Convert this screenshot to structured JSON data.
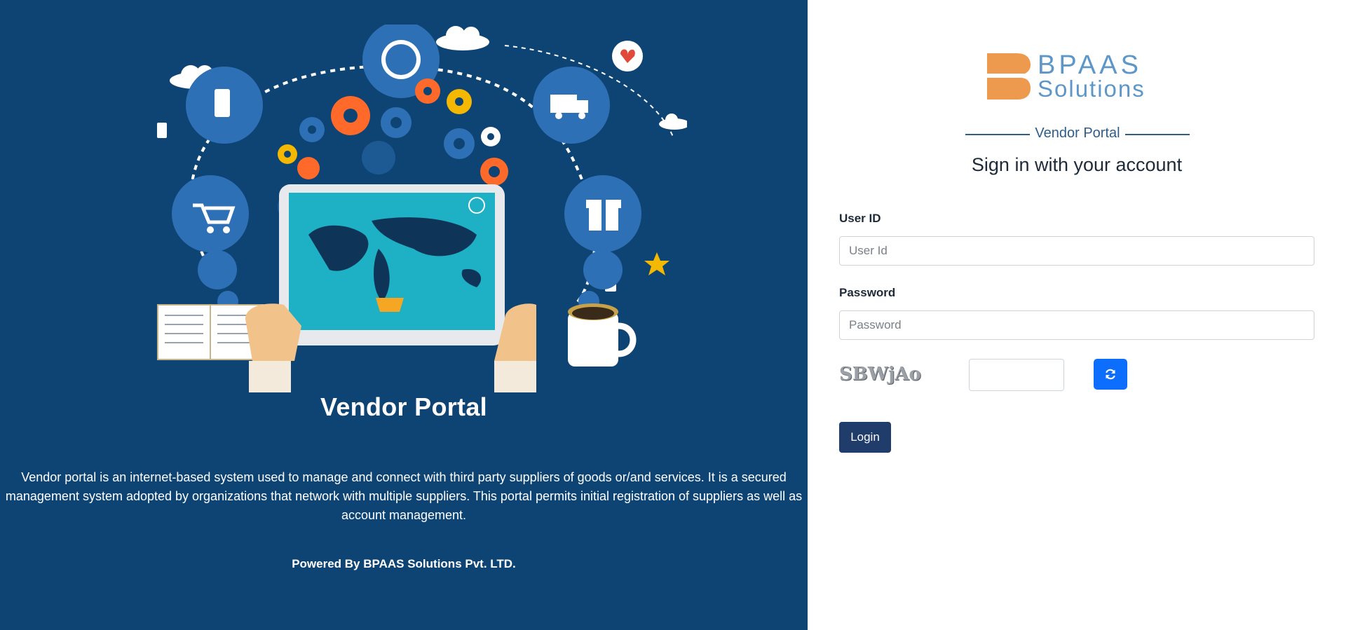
{
  "left": {
    "title": "Vendor Portal",
    "description": "Vendor portal is an internet-based system used to manage and connect with third party suppliers of goods or/and services. It is a secured management system adopted by organizations that network with multiple suppliers. This portal permits initial registration of suppliers as well as account management.",
    "powered_by": "Powered By BPAAS Solutions Pvt. LTD."
  },
  "logo": {
    "line1": "BPAAS",
    "line2": "Solutions",
    "mark_color": "#ee9a4e",
    "text_color": "#5d97c9"
  },
  "form": {
    "portal_label": "Vendor Portal",
    "heading": "Sign in with your account",
    "user_id_label": "User ID",
    "user_id_placeholder": "User Id",
    "password_label": "Password",
    "password_placeholder": "Password",
    "captcha_text": "SBWjAo",
    "refresh_icon": "refresh-icon",
    "login_label": "Login"
  },
  "colors": {
    "left_bg": "#0e4473",
    "login_button": "#1f3c6b",
    "refresh_button": "#0d6efd"
  }
}
